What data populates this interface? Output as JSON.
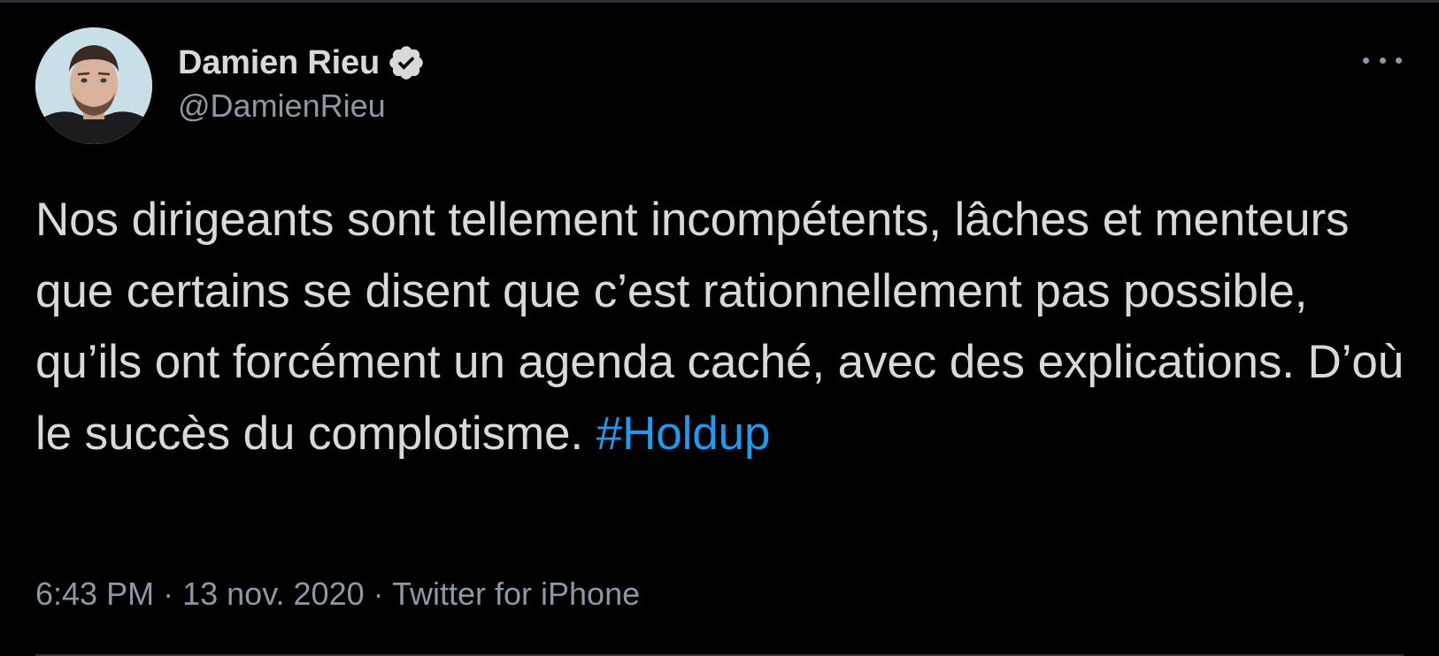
{
  "author": {
    "display_name": "Damien Rieu",
    "handle": "@DamienRieu",
    "verified": true
  },
  "tweet": {
    "text": "Nos dirigeants sont tellement incompétents, lâches et menteurs que certains se disent que c’est rationnellement pas possible, qu’ils ont forcément un agenda caché, avec des explications. D’où le succès du complotisme.",
    "hashtag": "#Holdup",
    "time": "6:43 PM",
    "date": "13 nov. 2020",
    "source": "Twitter for iPhone",
    "separator": "·"
  },
  "icons": {
    "verified": "verified-badge-icon",
    "more": "more-horizontal-icon"
  },
  "colors": {
    "background": "#000000",
    "text": "#d9d9d9",
    "secondary": "#8b98a5",
    "link": "#1d9bf0"
  }
}
